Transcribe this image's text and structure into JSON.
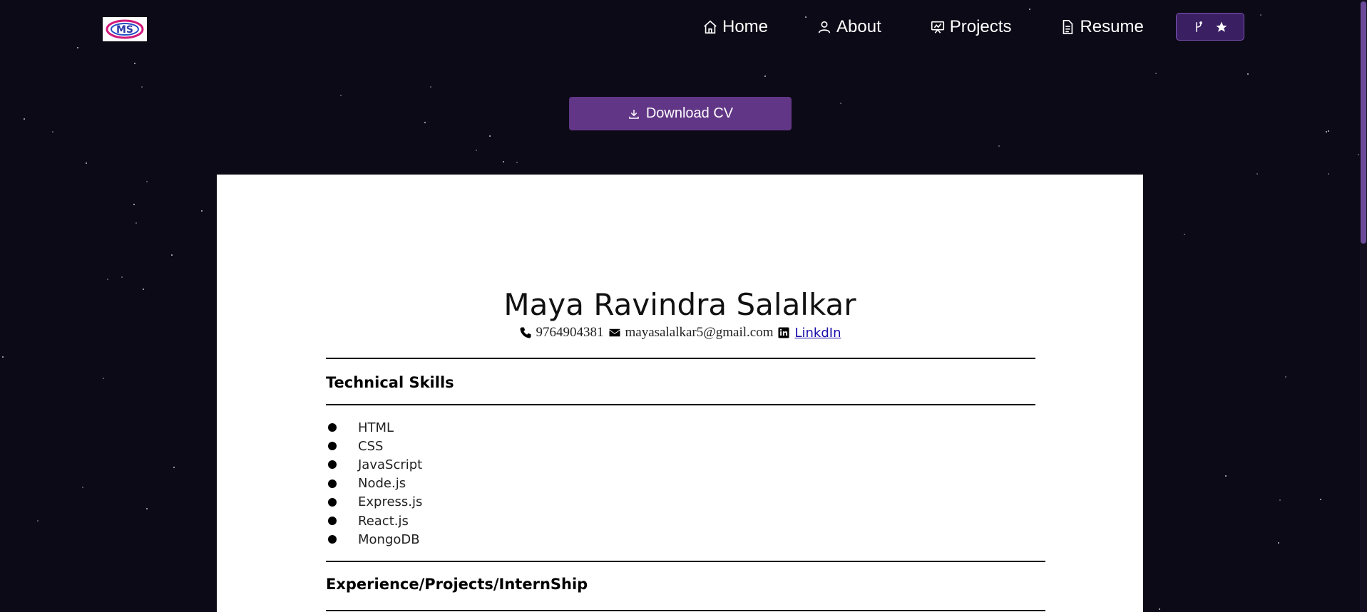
{
  "logo": {
    "text": "MS"
  },
  "nav": {
    "items": [
      {
        "label": "Home",
        "icon": "home-icon"
      },
      {
        "label": "About",
        "icon": "user-icon"
      },
      {
        "label": "Projects",
        "icon": "projects-icon"
      },
      {
        "label": "Resume",
        "icon": "document-icon"
      }
    ],
    "github_icons": [
      "fork-icon",
      "star-icon"
    ]
  },
  "download": {
    "label": "Download CV",
    "icon": "download-icon"
  },
  "resume": {
    "name": "Maya Ravindra Salalkar",
    "phone": "9764904381",
    "email": "mayasalalkar5@gmail.com",
    "linkedin_label": "LinkdIn",
    "sections": {
      "skills_title": "Technical Skills",
      "skills": [
        "HTML",
        "CSS",
        "JavaScript",
        "Node.js",
        "Express.js",
        "React.js",
        "MongoDB"
      ],
      "experience_title": "Experience/Projects/InternShip"
    }
  },
  "colors": {
    "background": "#0d0a17",
    "accent": "#623686",
    "github_button": "#3a2062",
    "link": "#1a0dab"
  }
}
